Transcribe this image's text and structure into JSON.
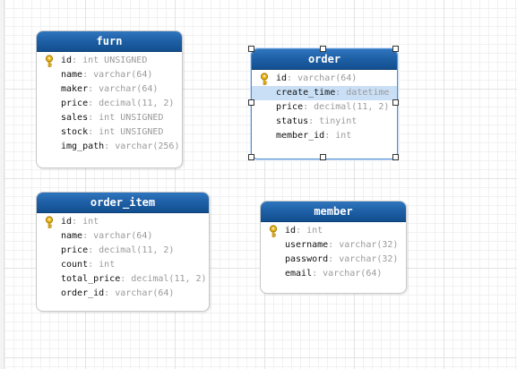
{
  "colors": {
    "header": "#1e5fa5",
    "selection_row": "#c9dff5",
    "selection_border": "#4f8fd3"
  },
  "tables": [
    {
      "name": "furn",
      "selected": false,
      "fields": [
        {
          "name": "id",
          "type": "int UNSIGNED",
          "pk": true
        },
        {
          "name": "name",
          "type": "varchar(64)"
        },
        {
          "name": "maker",
          "type": "varchar(64)"
        },
        {
          "name": "price",
          "type": "decimal(11, 2)"
        },
        {
          "name": "sales",
          "type": "int UNSIGNED"
        },
        {
          "name": "stock",
          "type": "int UNSIGNED"
        },
        {
          "name": "img_path",
          "type": "varchar(256)"
        }
      ]
    },
    {
      "name": "order",
      "selected": true,
      "fields": [
        {
          "name": "id",
          "type": "varchar(64)",
          "pk": true
        },
        {
          "name": "create_time",
          "type": "datetime",
          "highlighted": true
        },
        {
          "name": "price",
          "type": "decimal(11, 2)"
        },
        {
          "name": "status",
          "type": "tinyint"
        },
        {
          "name": "member_id",
          "type": "int"
        }
      ]
    },
    {
      "name": "order_item",
      "selected": false,
      "fields": [
        {
          "name": "id",
          "type": "int",
          "pk": true
        },
        {
          "name": "name",
          "type": "varchar(64)"
        },
        {
          "name": "price",
          "type": "decimal(11, 2)"
        },
        {
          "name": "count",
          "type": "int"
        },
        {
          "name": "total_price",
          "type": "decimal(11, 2)"
        },
        {
          "name": "order_id",
          "type": "varchar(64)"
        }
      ]
    },
    {
      "name": "member",
      "selected": false,
      "fields": [
        {
          "name": "id",
          "type": "int",
          "pk": true
        },
        {
          "name": "username",
          "type": "varchar(32)"
        },
        {
          "name": "password",
          "type": "varchar(32)"
        },
        {
          "name": "email",
          "type": "varchar(64)"
        }
      ]
    }
  ]
}
